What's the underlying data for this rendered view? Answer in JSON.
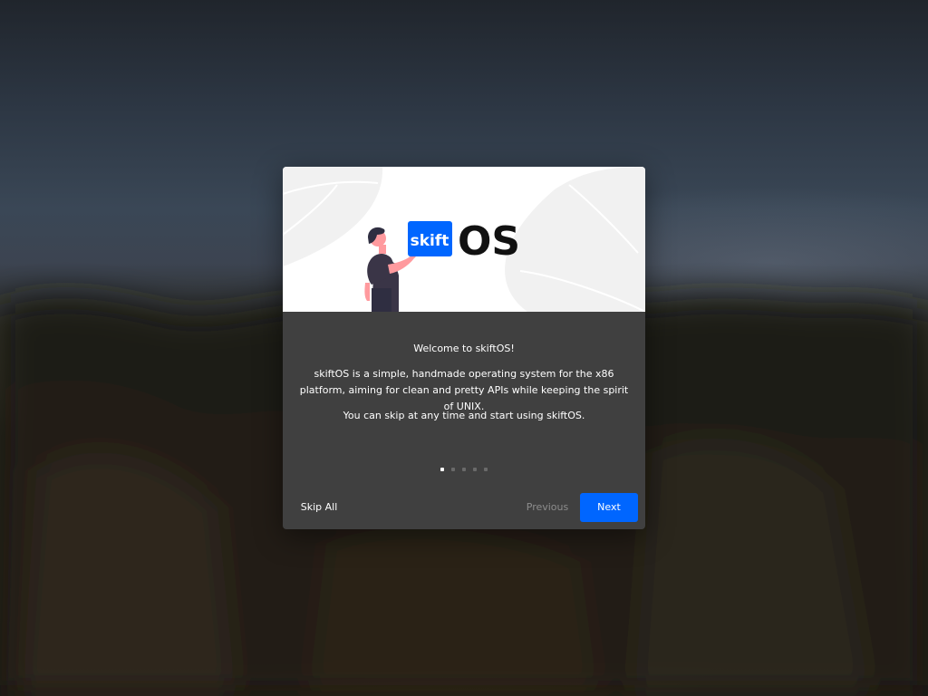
{
  "dialog": {
    "logo_text": "skift",
    "logo_suffix": "OS",
    "welcome": "Welcome to skiftOS!",
    "description": "skiftOS is a simple, handmade operating system for the x86 platform, aiming for clean and pretty APIs while keeping the spirit of UNIX.",
    "skip_note": "You can skip at any time and start using skiftOS.",
    "pages": {
      "total": 5,
      "current": 1
    },
    "buttons": {
      "skip_all": "Skip All",
      "previous": "Previous",
      "next": "Next"
    }
  },
  "colors": {
    "accent": "#0066ff",
    "dialog_background": "#404040",
    "banner_background": "#ffffff",
    "text": "#ffffff",
    "disabled_text": "#8d8d8d"
  },
  "icons": {
    "logo": "skift-logo-icon",
    "illustration": "person-presenting-illustration"
  }
}
